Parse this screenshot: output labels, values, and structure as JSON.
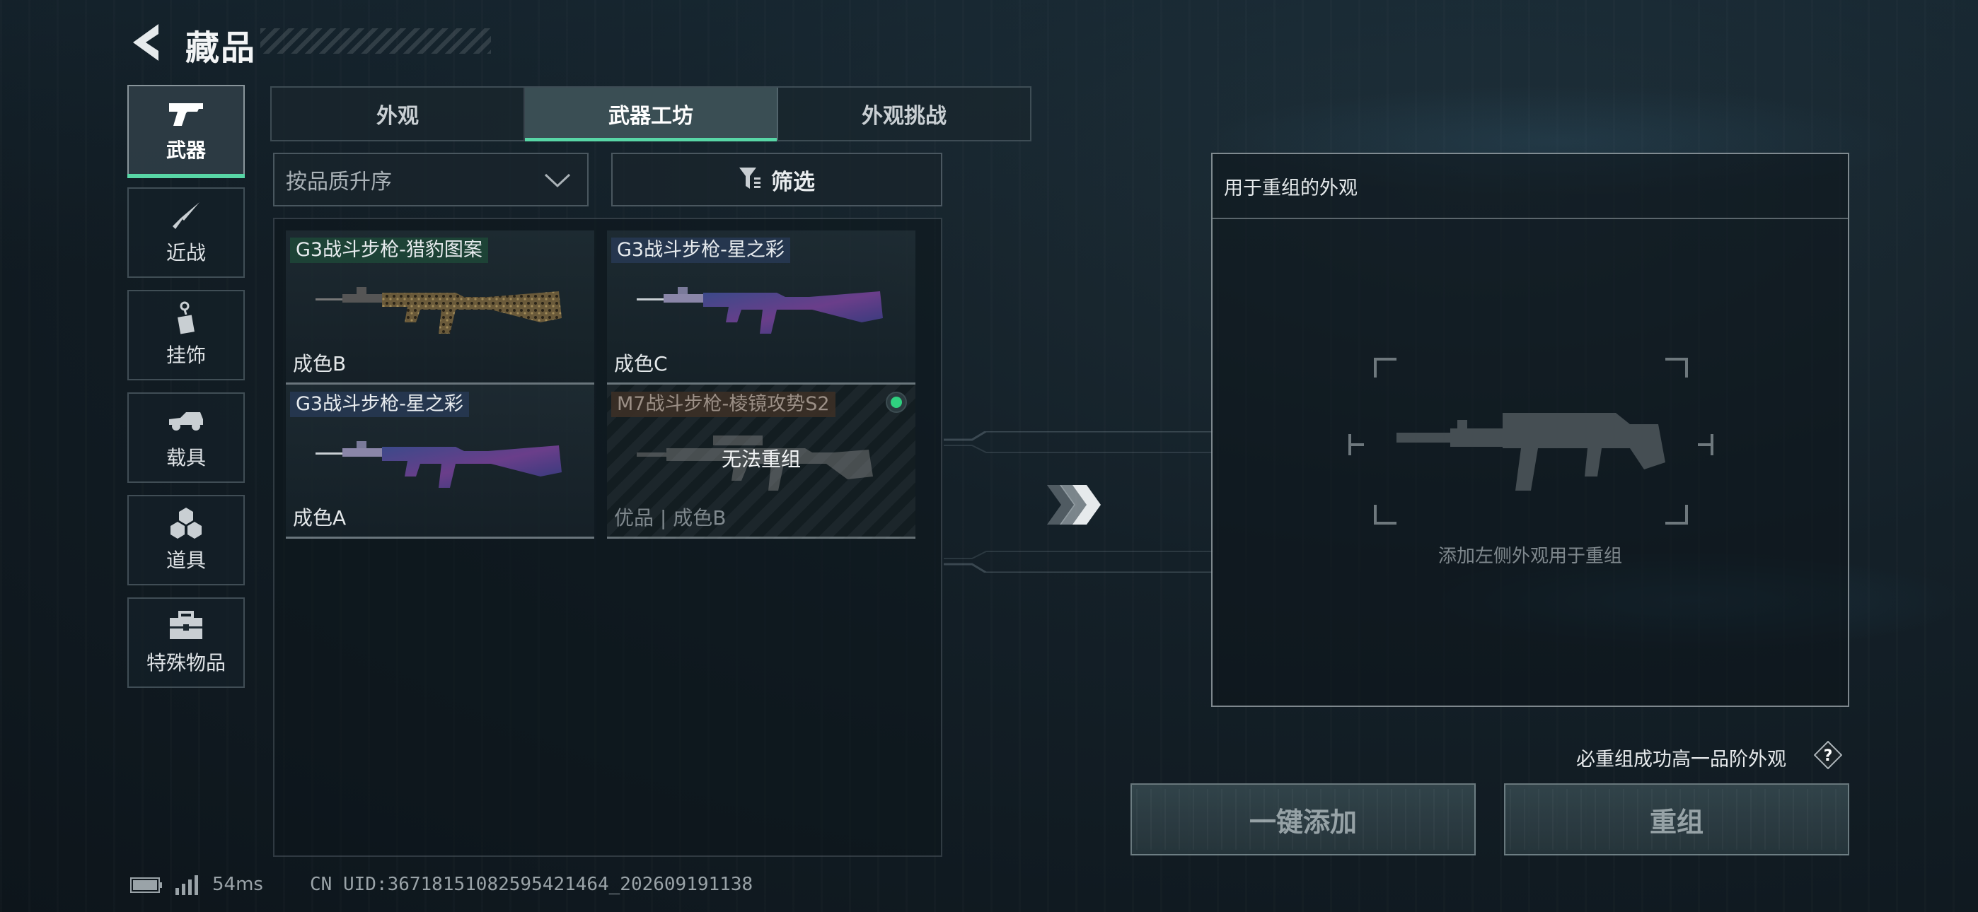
{
  "header": {
    "title": "藏品"
  },
  "sidebar": {
    "items": [
      {
        "label": "武器",
        "icon": "pistol-icon",
        "active": true
      },
      {
        "label": "近战",
        "icon": "knife-icon",
        "active": false
      },
      {
        "label": "挂饰",
        "icon": "charm-icon",
        "active": false
      },
      {
        "label": "载具",
        "icon": "vehicle-icon",
        "active": false
      },
      {
        "label": "道具",
        "icon": "props-icon",
        "active": false
      },
      {
        "label": "特殊物品",
        "icon": "toolbox-icon",
        "active": false
      }
    ]
  },
  "tabs": [
    {
      "label": "外观",
      "active": false
    },
    {
      "label": "武器工坊",
      "active": true
    },
    {
      "label": "外观挑战",
      "active": false
    }
  ],
  "toolbar": {
    "sort_value": "按品质升序",
    "filter_label": "筛选"
  },
  "items": [
    {
      "name": "G3战斗步枪-猎豹图案",
      "condition": "成色B",
      "tag_color": "green",
      "skin": "leopard"
    },
    {
      "name": "G3战斗步枪-星之彩",
      "condition": "成色C",
      "tag_color": "blue",
      "skin": "galaxy"
    },
    {
      "name": "G3战斗步枪-星之彩",
      "condition": "成色A",
      "tag_color": "blue",
      "skin": "galaxy"
    },
    {
      "name": "M7战斗步枪-棱镜攻势S2",
      "condition": "优品 | 成色B",
      "status": "无法重组",
      "tag_color": "brown",
      "equipped": true,
      "disabled": true
    }
  ],
  "recast": {
    "panel_title": "用于重组的外观",
    "hint": "添加左侧外观用于重组",
    "guarantee_text": "必重组成功高一品阶外观",
    "add_button": "一键添加",
    "recast_button": "重组"
  },
  "footer": {
    "ping": "54ms",
    "uid": "CN UID:36718151082595421464_202609191138"
  },
  "colors": {
    "accent": "#58d6a6",
    "equipped_dot": "#2fd07f"
  }
}
